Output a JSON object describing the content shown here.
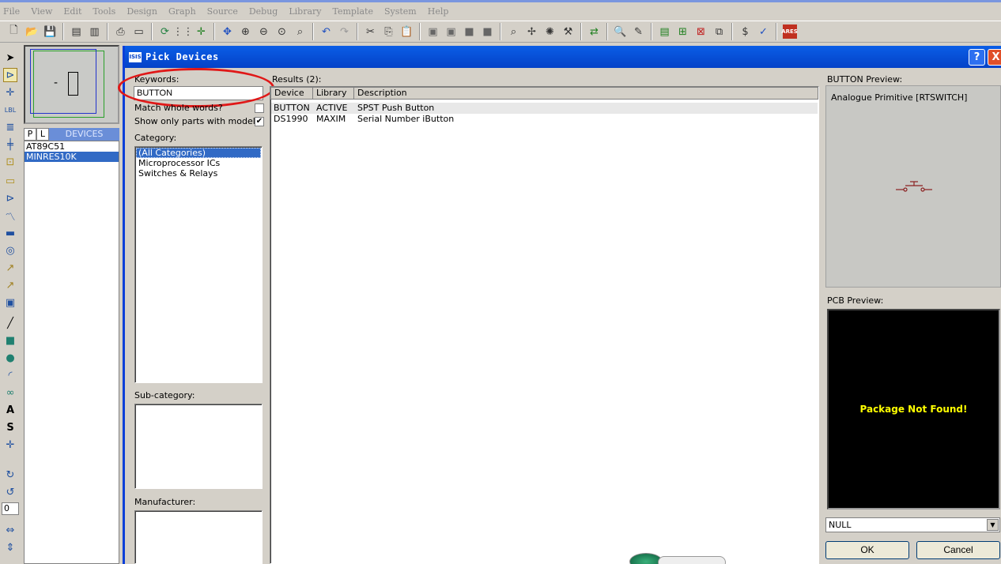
{
  "menu": [
    "File",
    "View",
    "Edit",
    "Tools",
    "Design",
    "Graph",
    "Source",
    "Debug",
    "Library",
    "Template",
    "System",
    "Help"
  ],
  "devices_panel": {
    "tab_p": "P",
    "tab_l": "L",
    "header": "DEVICES",
    "items": [
      "AT89C51",
      "MINRES10K"
    ],
    "selected_index": 1
  },
  "dialog": {
    "title_icon": "ISIS",
    "title": "Pick Devices",
    "help": "?",
    "close": "X",
    "keywords_label": "Keywords:",
    "keywords_value": "BUTTON",
    "match_whole_words": "Match whole words?",
    "match_whole_words_checked": false,
    "show_only_models": "Show only parts with models?",
    "show_only_models_checked": true,
    "category_label": "Category:",
    "categories": [
      "(All Categories)",
      "Microprocessor ICs",
      "Switches & Relays"
    ],
    "selected_category_index": 0,
    "subcategory_label": "Sub-category:",
    "manufacturer_label": "Manufacturer:",
    "results_label": "Results (2):",
    "results_columns": [
      "Device",
      "Library",
      "Description"
    ],
    "results": [
      {
        "device": "BUTTON",
        "library": "ACTIVE",
        "description": "SPST Push Button"
      },
      {
        "device": "DS1990",
        "library": "MAXIM",
        "description": "Serial Number iButton"
      }
    ],
    "preview_label": "BUTTON Preview:",
    "preview_text": "Analogue Primitive [RTSWITCH]",
    "pcb_label": "PCB Preview:",
    "pcb_message": "Package Not Found!",
    "package_select": "NULL",
    "ok_button": "OK",
    "cancel_button": "Cancel"
  },
  "left_zoom_value": "0",
  "colors": {
    "title_bar": "#0a5ee6",
    "selection": "#316ac5",
    "highlight_ellipse": "#e01818",
    "pcb_text": "#ffff00"
  }
}
